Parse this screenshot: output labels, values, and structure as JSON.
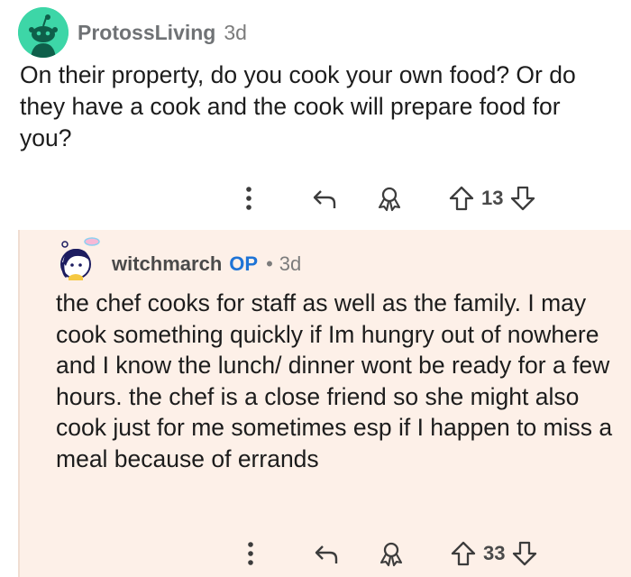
{
  "comment": {
    "username": "ProtossLiving",
    "time": "3d",
    "avatar_icon": "reddit-snoo-avatar-icon",
    "text": "On their property, do you cook your own food? Or do they have a cook and the cook will prepare food for you?",
    "votes": "13"
  },
  "reply": {
    "username": "witchmarch",
    "op_label": "OP",
    "separator": "•",
    "time": "3d",
    "avatar_icon": "custom-character-avatar-icon",
    "text": "the chef cooks for staff as well as the family. I may cook something quickly if Im hungry out of nowhere and I know the lunch/ dinner wont be ready for a few hours. the chef is a close friend so she might also cook just for me sometimes esp if I happen to miss a meal because of errands",
    "votes": "33"
  },
  "icons": {
    "more": "more-vertical-icon",
    "reply": "reply-arrow-icon",
    "award": "award-icon",
    "upvote": "upvote-arrow-icon",
    "downvote": "downvote-arrow-icon"
  },
  "colors": {
    "reply_background": "#fdf0e8",
    "op_badge": "#1f74d6",
    "avatar_green": "#3dd6a7"
  }
}
